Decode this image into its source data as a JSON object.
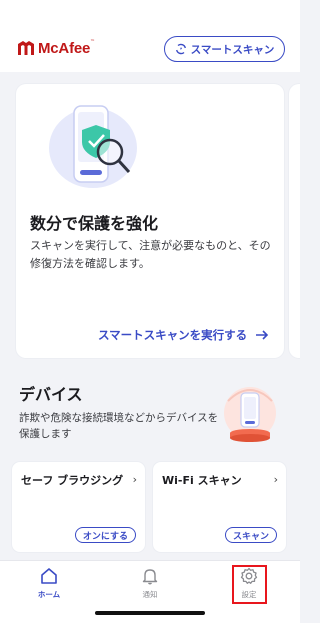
{
  "header": {
    "logo_text": "McAfee",
    "logo_tm": "™",
    "smart_scan_label": "スマートスキャン"
  },
  "hero": {
    "title": "数分で保護を強化",
    "description": "スキャンを実行して、注意が必要なものと、その修復方法を確認します。",
    "link_label": "スマートスキャンを実行する"
  },
  "devices": {
    "title": "デバイス",
    "description": "詐欺や危険な接続環境などからデバイスを保護します"
  },
  "features": [
    {
      "title": "セーフ ブラウジング",
      "button_label": "オンにする"
    },
    {
      "title": "Wi-Fi スキャン",
      "button_label": "スキャン"
    }
  ],
  "nav": {
    "home": "ホーム",
    "notifications": "通知",
    "settings": "設定"
  },
  "colors": {
    "brand_red": "#c01818",
    "accent_blue": "#3a4bc5",
    "highlight_red": "#e8161d"
  }
}
